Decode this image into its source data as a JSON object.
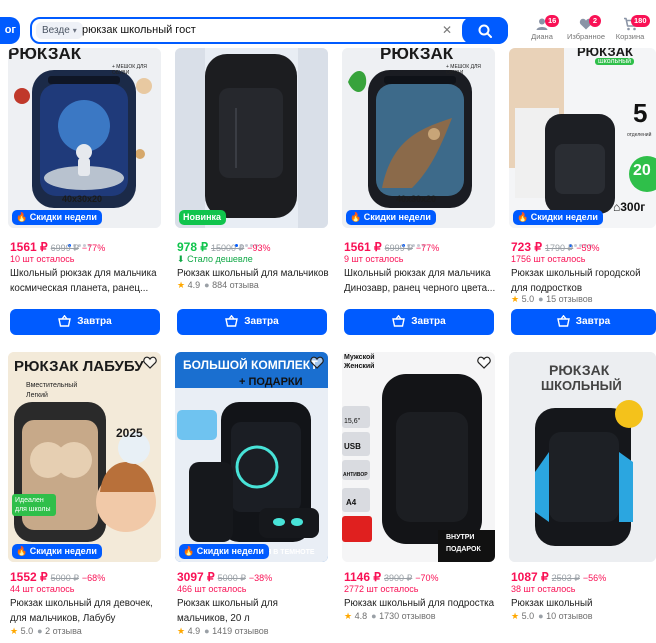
{
  "header": {
    "catalog_label": "ог",
    "search": {
      "scope": "Везде",
      "query": "рюкзак школьный гост"
    },
    "actions": [
      {
        "label": "Диана",
        "badge": "16",
        "icon": "user-icon"
      },
      {
        "label": "Избранное",
        "badge": "2",
        "icon": "heart-icon"
      },
      {
        "label": "Корзина",
        "badge": "180",
        "icon": "cart-icon"
      }
    ]
  },
  "colors": {
    "accent": "#005bff",
    "price": "#f91155",
    "promo_badge": "#005bff",
    "new_badge": "#10c44c"
  },
  "buy_label": "Завтра",
  "products": [
    {
      "image_text": [
        "РЮКЗАК",
        "+ МЕШОК ДЛЯ ОБУВИ",
        "40x30x20"
      ],
      "badge": "Скидки недели",
      "price": "1561 ₽",
      "old_price": "6999 ₽",
      "discount": "−77%",
      "stock": "10 шт осталось",
      "title": "Школьный рюкзак для мальчика космическая планета, ранец...",
      "rating": null,
      "reviews": null
    },
    {
      "image_text": [],
      "badge": "Новинка",
      "price": "978 ₽",
      "old_price": "15000 ₽",
      "discount": "−93%",
      "stock": "Стало дешевле",
      "title": "Рюкзак школьный для мальчиков",
      "rating": "4.9",
      "reviews": "884 отзыва"
    },
    {
      "image_text": [
        "РЮКЗАК",
        "+ МЕШОК ДЛЯ ОБУВИ",
        "40x30x20"
      ],
      "badge": "Скидки недели",
      "price": "1561 ₽",
      "old_price": "6999 ₽",
      "discount": "−77%",
      "stock": "9 шт осталось",
      "title": "Школьный рюкзак для мальчика Динозавр, ранец черного цвета...",
      "rating": null,
      "reviews": null
    },
    {
      "image_text": [
        "РЮКЗАК",
        "школьный",
        "5",
        "отделений",
        "20",
        "300г"
      ],
      "badge": "Скидки недели",
      "price": "723 ₽",
      "old_price": "1790 ₽",
      "discount": "−59%",
      "stock": "1756 шт осталось",
      "title": "Рюкзак школьный городской для подростков",
      "rating": "5.0",
      "reviews": "15 отзывов"
    },
    {
      "image_text": [
        "РЮКЗАК ЛАБУБУ",
        "Вместительный",
        "Легкий",
        "2025",
        "Идеален для школы"
      ],
      "badge": "Скидки недели",
      "price": "1552 ₽",
      "old_price": "5000 ₽",
      "discount": "−68%",
      "stock": "44 шт осталось",
      "title": "Рюкзак школьный для девочек, для мальчиков, Лабубу",
      "rating": "5.0",
      "reviews": "2 отзыва"
    },
    {
      "image_text": [
        "БОЛЬШОЙ КОМПЛЕКТ",
        "+ ПОДАРКИ",
        "ТСЯ В ТЕМНОТЕ"
      ],
      "badge": "Скидки недели",
      "price": "3097 ₽",
      "old_price": "5000 ₽",
      "discount": "−38%",
      "stock": "466 шт осталось",
      "title": "Рюкзак школьный для мальчиков, 20 л",
      "rating": "4.9",
      "reviews": "1419 отзывов"
    },
    {
      "image_text": [
        "Мужской",
        "Женский",
        "15,6\"",
        "USB",
        "АНТИВОР",
        "A4",
        "ВНУТРИ",
        "ПОДАРОК"
      ],
      "badge": null,
      "price": "1146 ₽",
      "old_price": "3900 ₽",
      "discount": "−70%",
      "stock": "2772 шт осталось",
      "title": "Рюкзак школьный для подростка",
      "rating": "4.8",
      "reviews": "1730 отзывов"
    },
    {
      "image_text": [
        "РЮКЗАК",
        "ШКОЛЬНЫЙ"
      ],
      "badge": null,
      "price": "1087 ₽",
      "old_price": "2503 ₽",
      "discount": "−56%",
      "stock": "38 шт осталось",
      "title": "Рюкзак школьный",
      "rating": "5.0",
      "reviews": "10 отзывов"
    }
  ]
}
